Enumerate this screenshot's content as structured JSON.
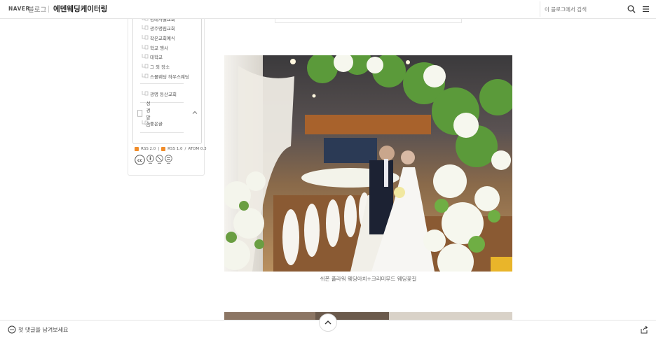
{
  "header": {
    "naver_logo": "NAVER",
    "blog_label": "블로그",
    "blog_title": "에덴웨딩케이터링",
    "search_placeholder": "이 블로그에서 검색"
  },
  "sidebar": {
    "categories": [
      {
        "label": "명례사월교회"
      },
      {
        "label": "광주명림교회"
      },
      {
        "label": "작은교회예식"
      },
      {
        "label": "학교 행사"
      },
      {
        "label": "대학교"
      },
      {
        "label": "그 외 장소"
      },
      {
        "label": "스몰웨딩 하우스웨딩"
      }
    ],
    "extra_category": {
      "label": "광명 동산교회"
    },
    "group": {
      "label": "성경말씀",
      "children": [
        {
          "label": "좋은글"
        }
      ]
    },
    "rss": {
      "rss2": "RSS 2.0",
      "rss1": "RSS 1.0",
      "atom": "ATOM 0.3"
    }
  },
  "post": {
    "caption": "쉬폰 플라워 웨딩아치+크리미무드 웨딩꽃길"
  },
  "bottombar": {
    "comment_prompt": "첫 댓글을 남겨보세요"
  }
}
